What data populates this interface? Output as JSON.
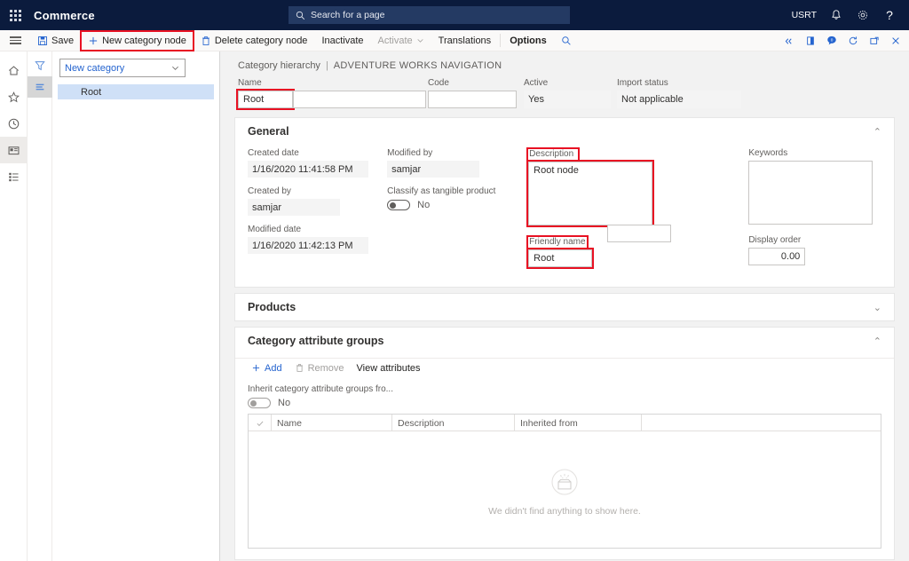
{
  "topbar": {
    "waffle_name": "app-launcher",
    "app_title": "Commerce",
    "search_placeholder": "Search for a page",
    "company": "USRT",
    "icons": [
      "notifications-icon",
      "settings-icon",
      "help-icon"
    ]
  },
  "commandbar": {
    "save_label": "Save",
    "new_node_label": "New category node",
    "delete_node_label": "Delete category node",
    "inactivate_label": "Inactivate",
    "activate_label": "Activate",
    "translations_label": "Translations",
    "options_label": "Options",
    "search_icon": "search-icon",
    "right_icons": [
      "collapse-icon",
      "office-app-icon",
      "messages-badge-icon",
      "refresh-icon",
      "popout-icon",
      "close-icon"
    ],
    "message_badge_count": "0",
    "highlight_color": "#e81123"
  },
  "navrail": {
    "items": [
      "home-icon",
      "favorites-icon",
      "recent-icon",
      "workspaces-icon",
      "modules-icon"
    ]
  },
  "treepane": {
    "tabs": [
      "filter-icon",
      "list-icon"
    ],
    "dropdown_value": "New category",
    "nodes": [
      {
        "label": "Root",
        "selected": true
      }
    ]
  },
  "breadcrumb": {
    "parent": "Category hierarchy",
    "separator": "|",
    "current": "ADVENTURE WORKS NAVIGATION"
  },
  "header_fields": {
    "name_label": "Name",
    "name_value": "Root",
    "code_label": "Code",
    "code_value": "",
    "active_label": "Active",
    "active_value": "Yes",
    "import_status_label": "Import status",
    "import_status_value": "Not applicable"
  },
  "general": {
    "title": "General",
    "expanded_chevron": "⌃",
    "created_date_label": "Created date",
    "created_date_value": "1/16/2020 11:41:58 PM",
    "created_by_label": "Created by",
    "created_by_value": "samjar",
    "modified_date_label": "Modified date",
    "modified_date_value": "1/16/2020 11:42:13 PM",
    "modified_by_label": "Modified by",
    "modified_by_value": "samjar",
    "classify_label": "Classify as tangible product",
    "classify_value": "No",
    "description_label": "Description",
    "description_value": "Root node",
    "friendly_name_label": "Friendly name",
    "friendly_name_value": "Root",
    "keywords_label": "Keywords",
    "keywords_value": "",
    "display_order_label": "Display order",
    "display_order_value": "0.00"
  },
  "products": {
    "title": "Products",
    "collapsed_chevron": "⌄"
  },
  "attribute_groups": {
    "title": "Category attribute groups",
    "expanded_chevron": "⌃",
    "add_label": "Add",
    "remove_label": "Remove",
    "view_attributes_label": "View attributes",
    "inherit_label": "Inherit category attribute groups fro...",
    "inherit_value": "No",
    "columns": [
      "Name",
      "Description",
      "Inherited from"
    ],
    "rows": [],
    "empty_message": "We didn't find anything to show here.",
    "empty_icon": "empty-box-icon"
  }
}
